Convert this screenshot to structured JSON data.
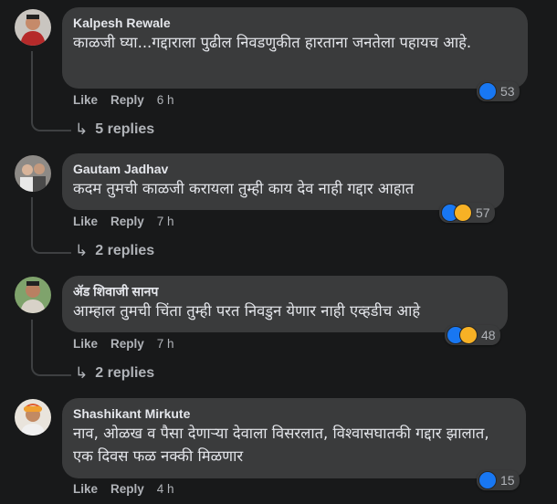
{
  "actions": {
    "like": "Like",
    "reply": "Reply"
  },
  "comments": [
    {
      "author": "Kalpesh Rewale",
      "text": "काळजी घ्या...गद्दाराला पुढील निवडणुकीत हारताना जनतेला पहायच आहे.",
      "time": "6 h",
      "reactions": [
        "like"
      ],
      "reaction_count": "53",
      "replies_label": "5 replies"
    },
    {
      "author": "Gautam Jadhav",
      "text": "कदम तुमची काळजी करायला तुम्ही काय देव नाही गद्दार आहात",
      "time": "7 h",
      "reactions": [
        "like",
        "haha"
      ],
      "reaction_count": "57",
      "replies_label": "2 replies"
    },
    {
      "author": "ॲड शिवाजी सानप",
      "text": "आम्हाल तुमची चिंता तुम्ही परत निवडुन येणार नाही एव्हडीच आहे",
      "time": "7 h",
      "reactions": [
        "like",
        "haha"
      ],
      "reaction_count": "48",
      "replies_label": "2 replies"
    },
    {
      "author": "Shashikant Mirkute",
      "text": "नाव, ओळख व पैसा देणाऱ्या देवाला विसरलात, विश्वासघातकी गद्दार झालात, एक दिवस फळ नक्की मिळणार",
      "time": "4 h",
      "reactions": [
        "like"
      ],
      "reaction_count": "15"
    }
  ],
  "colors": {
    "background": "#18191a",
    "bubble": "#3a3b3c",
    "like_blue": "#1877f2",
    "haha_yellow": "#f7b125",
    "secondary_text": "#b0b3b8"
  }
}
